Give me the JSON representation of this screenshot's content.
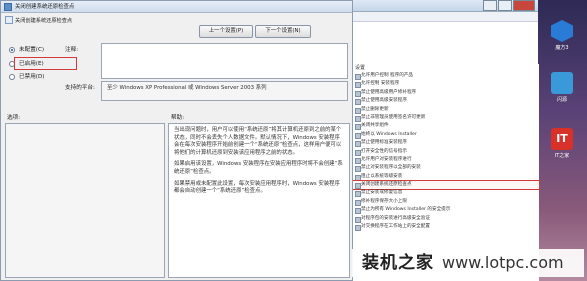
{
  "dialog": {
    "title": "关闭创建系统还原检查点",
    "subtitle": "关闭创建系统还原检查点",
    "prev_button": "上一个设置(P)",
    "next_button": "下一个设置(N)",
    "radio_options": [
      {
        "label": "未配置(C)",
        "selected": true
      },
      {
        "label": "已启用(E)",
        "selected": false
      },
      {
        "label": "已禁用(D)",
        "selected": false
      }
    ],
    "comment_label": "注释:",
    "supported_label": "支持的平台:",
    "supported_value": "至少 Windows XP Professional 或 Windows Server 2003 系列",
    "options_label": "选项:",
    "help_label": "帮助:",
    "help_paragraphs": [
      "当出现问题时，用户可以使用“系统还原”将其计算机还原到之前的某个状态，同时不会丢失个人数据文件。默认情况下，Windows 安装程序会在每次安装程序开始前创建一个“系统还原”检查点，这样用户便可以将他们的计算机还原到安装该应用程序之前的状态。",
      "如果启用该设置，Windows 安装程序在安装应用程序时将不会创建“系统还原”检查点。",
      "如果禁用或未配置此设置，每次安装应用程序时，Windows 安装程序都会自动创建一个“系统还原”检查点。"
    ]
  },
  "background_window": {
    "pane_header": "设置",
    "policy_items": [
      "允许用户控制 程序的产品",
      "允许控制 安装程序",
      "禁止使用高级用户修补程序",
      "禁止使用高级安装程序",
      "禁止删除更新",
      "禁止非管理员使用签名许可更新",
      "关闭共享组件",
      "始终以 Windows Installer",
      "禁止使用标准安装程序",
      "打开安全性的信号指示",
      "允许用户对安装程序进行",
      "禁止对安装程序以全部的安装",
      "阻止以系统等级安装",
      "关闭创建系统还原检查点",
      "禁止安装或修复信息",
      "修补程序保存大小上限",
      "禁止为所有 Windows Installer 的安全提示",
      "对程序包的安装进行高级安全验证",
      "对交换程序在工作站上的安全配置"
    ],
    "highlighted_index": 13
  },
  "desktop": {
    "icons": [
      {
        "label": "魔方3",
        "icon": "cube-icon"
      },
      {
        "label": "闪源",
        "icon": "lightning-icon"
      },
      {
        "label": "IT之家",
        "icon": "it-logo-icon"
      }
    ],
    "it_logo_text": "IT"
  },
  "watermark": {
    "text": "装机之家",
    "url": "www.lotpc.com"
  },
  "colors": {
    "highlight_red": "#d23a3a",
    "dialog_bg": "#f0f0f0",
    "title_blue": "#cfdcec"
  }
}
